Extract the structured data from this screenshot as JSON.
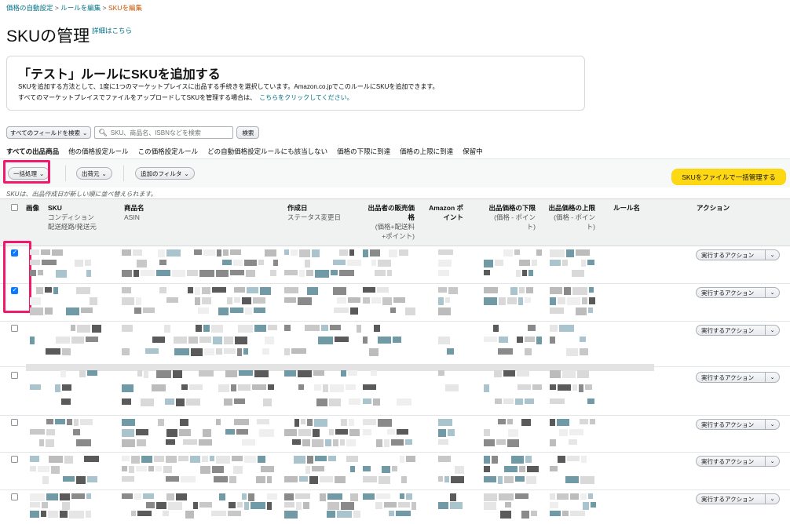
{
  "breadcrumb": {
    "item1": "価格の自動設定",
    "sep": ">",
    "item2": "ルールを編集",
    "current": "SKUを編集"
  },
  "page": {
    "title": "SKUの管理",
    "details_link": "詳細はこちら"
  },
  "info_box": {
    "title": "「テスト」ルールにSKUを追加する",
    "line1": "SKUを追加する方法として、1度に1つのマーケットプレイスに出品する手続きを選択しています。Amazon.co.jpでこのルールにSKUを追加できます。",
    "line2": "すべてのマーケットプレイスでファイルをアップロードしてSKUを管理する場合は、",
    "line2_link": "こちらをクリックしてください。"
  },
  "search": {
    "field_select": "すべてのフィールドを検索",
    "placeholder": "SKU、商品名、ISBNなどを検索",
    "button": "検索"
  },
  "tabs": [
    {
      "label": "すべての出品商品",
      "active": true
    },
    {
      "label": "他の価格設定ルール"
    },
    {
      "label": "この価格設定ルール"
    },
    {
      "label": "どの自動価格設定ルールにも該当しない"
    },
    {
      "label": "価格の下限に到達"
    },
    {
      "label": "価格の上限に到達"
    },
    {
      "label": "保留中"
    }
  ],
  "filters": {
    "bulk": "一括処理",
    "ship_from": "出荷元",
    "add_filter": "追加のフィルタ",
    "manage_file": "SKUをファイルで一括管理する"
  },
  "sort_note": "SKUは、出品作成日が新しい順に並べ替えられます。",
  "columns": {
    "image": "画像",
    "sku": "SKU",
    "sku_sub1": "コンディション",
    "sku_sub2": "配送経路/発送元",
    "name": "商品名",
    "name_sub": "ASIN",
    "created": "作成日",
    "created_sub": "ステータス変更日",
    "seller_price_l1": "出品者の販売価",
    "seller_price_l2": "格",
    "seller_price_sub1": "(価格+配送料",
    "seller_price_sub2": "+ポイント)",
    "amazon_point_l1": "Amazon ポ",
    "amazon_point_l2": "イント",
    "min_price": "出品価格の下限",
    "min_price_sub1": "(価格 - ポイン",
    "min_price_sub2": "ト)",
    "max_price": "出品価格の上限",
    "max_price_sub1": "(価格 - ポイン",
    "max_price_sub2": "ト)",
    "rule_name": "ルール名",
    "action": "アクション"
  },
  "rows": [
    {
      "checked": true,
      "action": "実行するアクション"
    },
    {
      "checked": true,
      "action": "実行するアクション"
    },
    {
      "checked": false,
      "action": "実行するアクション"
    },
    {
      "checked": false,
      "action": "実行するアクション"
    },
    {
      "checked": false,
      "action": "実行するアクション"
    },
    {
      "checked": false,
      "action": "実行するアクション"
    },
    {
      "checked": false,
      "action": "実行するアクション"
    }
  ],
  "colors": {
    "link": "#007185",
    "highlight": "#f0196b",
    "primary_button": "#ffd814",
    "tab_underline": "#e77600",
    "checkbox": "#0a7aff"
  }
}
